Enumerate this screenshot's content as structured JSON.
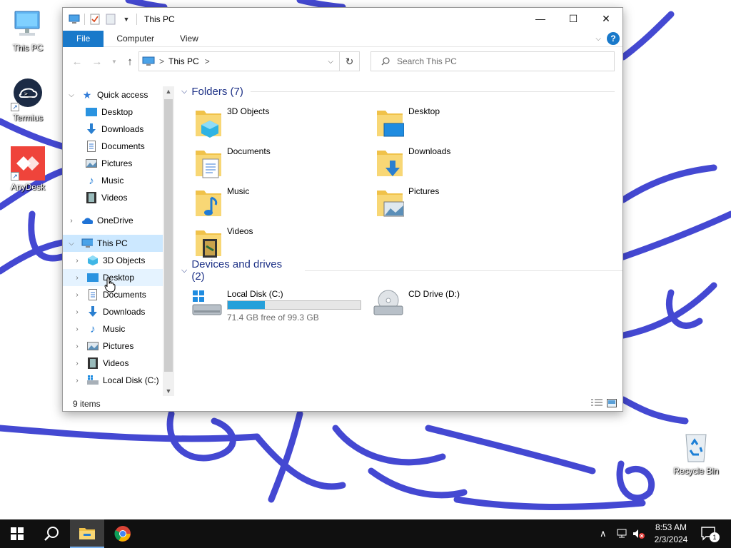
{
  "desktop": {
    "icons": [
      {
        "label": "This PC",
        "icon": "this-pc-icon"
      },
      {
        "label": "Termius",
        "icon": "termius-icon"
      },
      {
        "label": "AnyDesk",
        "icon": "anydesk-icon"
      },
      {
        "label": "Recycle Bin",
        "icon": "recycle-bin-icon"
      }
    ],
    "wallpaper_color": "#3a3fd0"
  },
  "window": {
    "title": "This PC",
    "ribbon_tabs": [
      "File",
      "Computer",
      "View"
    ],
    "help_label": "?",
    "minimize": "—",
    "maximize": "☐",
    "close": "✕"
  },
  "address": {
    "segments": [
      "This PC"
    ],
    "separator": ">",
    "search_placeholder": "Search This PC"
  },
  "nav": {
    "quick_access": {
      "label": "Quick access",
      "items": [
        {
          "label": "Desktop",
          "pinned": true,
          "icon": "desktop-icon"
        },
        {
          "label": "Downloads",
          "pinned": true,
          "icon": "downloads-icon"
        },
        {
          "label": "Documents",
          "pinned": true,
          "icon": "documents-icon"
        },
        {
          "label": "Pictures",
          "pinned": true,
          "icon": "pictures-icon"
        },
        {
          "label": "Music",
          "pinned": false,
          "icon": "music-icon"
        },
        {
          "label": "Videos",
          "pinned": false,
          "icon": "videos-icon"
        }
      ]
    },
    "onedrive": {
      "label": "OneDrive"
    },
    "this_pc": {
      "label": "This PC",
      "items": [
        {
          "label": "3D Objects",
          "icon": "3d-objects-icon"
        },
        {
          "label": "Desktop",
          "icon": "desktop-icon"
        },
        {
          "label": "Documents",
          "icon": "documents-icon"
        },
        {
          "label": "Downloads",
          "icon": "downloads-icon"
        },
        {
          "label": "Music",
          "icon": "music-icon"
        },
        {
          "label": "Pictures",
          "icon": "pictures-icon"
        },
        {
          "label": "Videos",
          "icon": "videos-icon"
        },
        {
          "label": "Local Disk (C:)",
          "icon": "local-disk-icon"
        }
      ]
    }
  },
  "content": {
    "folders_header": "Folders (7)",
    "folders": [
      {
        "label": "3D Objects",
        "icon": "3d-objects-folder-icon"
      },
      {
        "label": "Desktop",
        "icon": "desktop-folder-icon"
      },
      {
        "label": "Documents",
        "icon": "documents-folder-icon"
      },
      {
        "label": "Downloads",
        "icon": "downloads-folder-icon"
      },
      {
        "label": "Music",
        "icon": "music-folder-icon"
      },
      {
        "label": "Pictures",
        "icon": "pictures-folder-icon"
      },
      {
        "label": "Videos",
        "icon": "videos-folder-icon"
      }
    ],
    "drives_header": "Devices and drives (2)",
    "drives": [
      {
        "label": "Local Disk (C:)",
        "free_text": "71.4 GB free of 99.3 GB",
        "used_fraction": 0.28,
        "icon": "local-disk-drive-icon"
      },
      {
        "label": "CD Drive (D:)",
        "icon": "cd-drive-icon"
      }
    ]
  },
  "status": {
    "items_text": "9 items"
  },
  "taskbar": {
    "time": "8:53 AM",
    "date": "2/3/2024",
    "notification_count": "1",
    "accent": "#7ab3f0"
  }
}
